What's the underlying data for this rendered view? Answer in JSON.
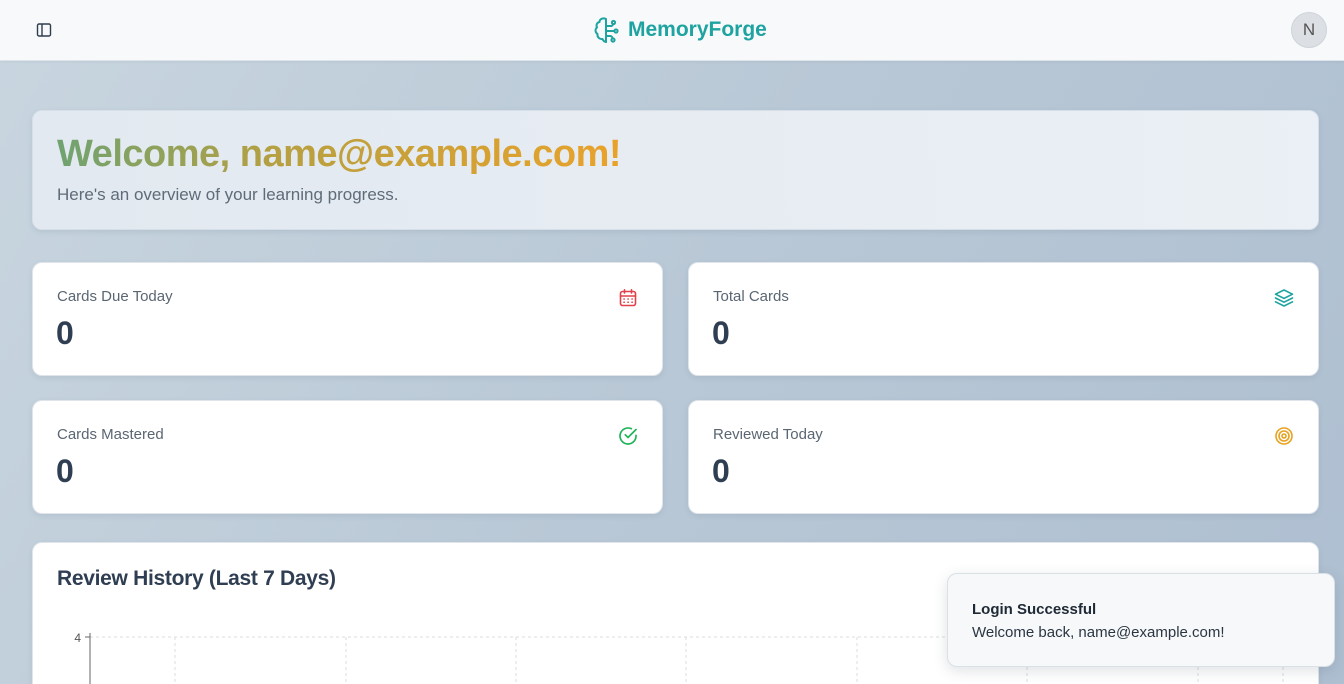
{
  "header": {
    "brand_name": "MemoryForge",
    "avatar_initial": "N",
    "brand_color": "#1fa3a0"
  },
  "welcome": {
    "title": "Welcome, name@example.com!",
    "subtitle": "Here's an overview of your learning progress."
  },
  "stats": [
    {
      "label": "Cards Due Today",
      "value": "0",
      "icon": "calendar-icon",
      "color": "#e0414a"
    },
    {
      "label": "Total Cards",
      "value": "0",
      "icon": "layers-icon",
      "color": "#1fa3a0"
    },
    {
      "label": "Cards Mastered",
      "value": "0",
      "icon": "check-circle-icon",
      "color": "#22b35a"
    },
    {
      "label": "Reviewed Today",
      "value": "0",
      "icon": "target-icon",
      "color": "#e7a21f"
    }
  ],
  "history": {
    "title": "Review History (Last 7 Days)",
    "y_tick_top": "4"
  },
  "chart_data": {
    "type": "bar",
    "title": "Review History (Last 7 Days)",
    "y_ticks": [
      "4"
    ],
    "ylim": [
      0,
      4
    ],
    "grid": true
  },
  "toast": {
    "title": "Login Successful",
    "message": "Welcome back, name@example.com!"
  }
}
